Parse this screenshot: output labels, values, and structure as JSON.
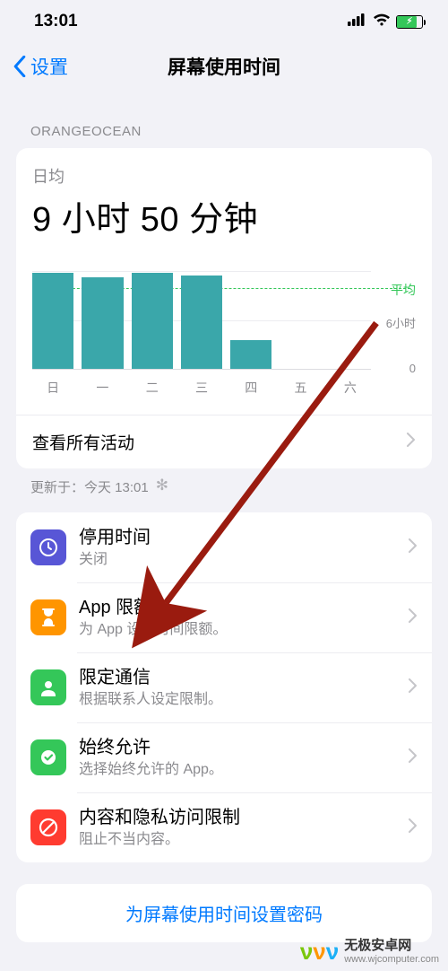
{
  "status": {
    "time": "13:01"
  },
  "nav": {
    "back_label": "设置",
    "title": "屏幕使用时间"
  },
  "section_header": "ORANGEOCEAN",
  "summary": {
    "avg_label": "日均",
    "avg_value": "9 小时 50 分钟",
    "see_all": "查看所有活动",
    "updated": "更新于：今天 13:01"
  },
  "chart_data": {
    "type": "bar",
    "categories": [
      "日",
      "一",
      "二",
      "三",
      "四",
      "五",
      "六"
    ],
    "values": [
      11.8,
      11.2,
      11.8,
      11.5,
      3.5,
      0,
      0
    ],
    "avg_line_value": 9.8,
    "ylabel_ticks": {
      "mid": "6小时",
      "bottom": "0"
    },
    "avg_tag": "平均",
    "ylim": [
      0,
      12
    ]
  },
  "rows": [
    {
      "id": "downtime",
      "title": "停用时间",
      "sub": "关闭",
      "icon_bg": "#5856d6"
    },
    {
      "id": "app-limits",
      "title": "App 限额",
      "sub": "为 App 设置时间限额。",
      "icon_bg": "#ff9500"
    },
    {
      "id": "communication",
      "title": "限定通信",
      "sub": "根据联系人设定限制。",
      "icon_bg": "#34c759"
    },
    {
      "id": "always-allowed",
      "title": "始终允许",
      "sub": "选择始终允许的 App。",
      "icon_bg": "#34c759"
    },
    {
      "id": "content-privacy",
      "title": "内容和隐私访问限制",
      "sub": "阻止不当内容。",
      "icon_bg": "#ff3b30"
    }
  ],
  "passcode_link": "为屏幕使用时间设置密码",
  "watermark": {
    "brand": "无极安卓网",
    "url": "www.wjcomputer.com"
  }
}
